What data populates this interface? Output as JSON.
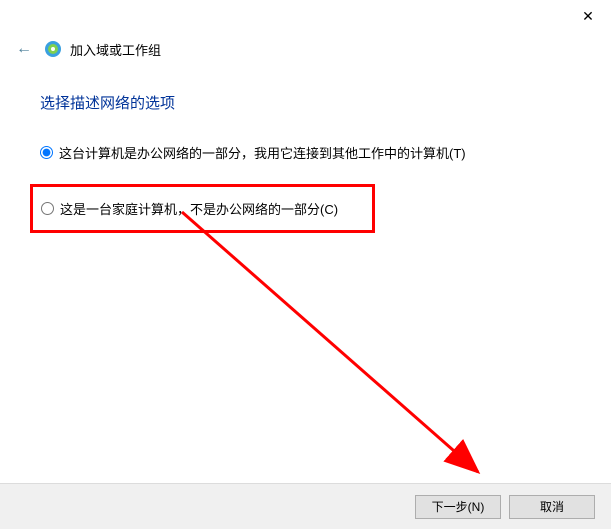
{
  "titlebar": {
    "close_label": "✕"
  },
  "header": {
    "back_label": "←",
    "title": "加入域或工作组"
  },
  "page": {
    "heading": "选择描述网络的选项"
  },
  "options": {
    "office": {
      "label": "这台计算机是办公网络的一部分，我用它连接到其他工作中的计算机(T)",
      "selected": true
    },
    "home": {
      "label": "这是一台家庭计算机，不是办公网络的一部分(C)",
      "selected": false
    }
  },
  "buttons": {
    "next": "下一步(N)",
    "cancel": "取消"
  },
  "annotation": {
    "highlight_target": "home-option",
    "arrow_color": "#ff0000"
  }
}
